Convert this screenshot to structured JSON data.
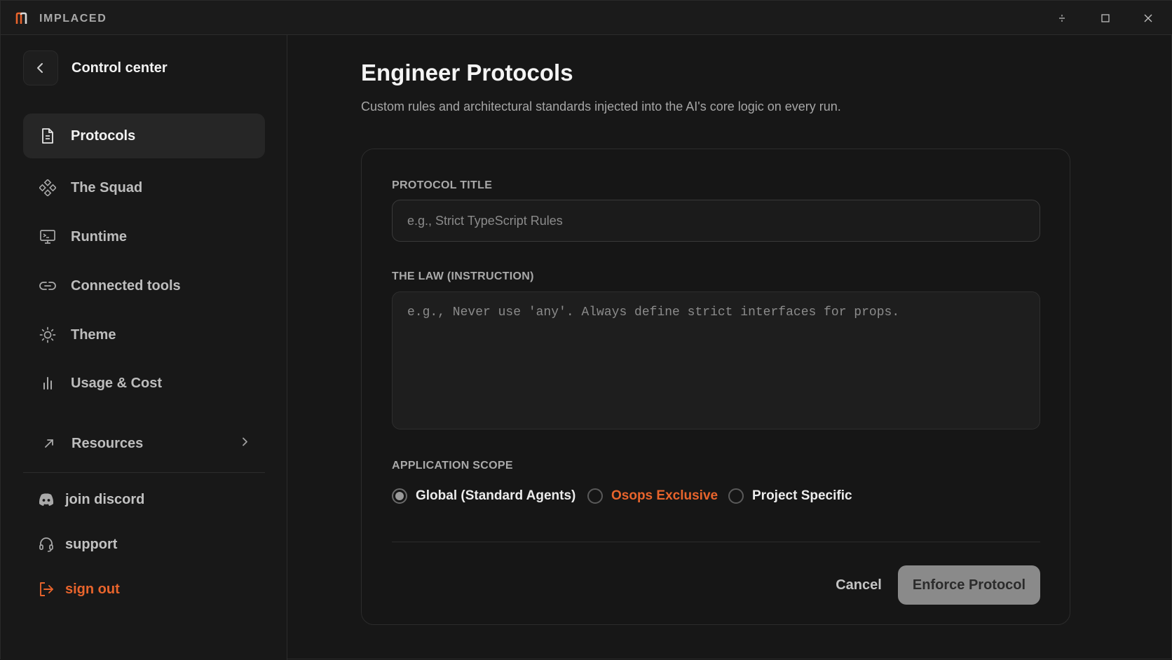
{
  "app": {
    "name": "IMPLACED"
  },
  "sidebar": {
    "title": "Control center",
    "items": [
      {
        "label": "Protocols",
        "icon": "document-icon",
        "active": true
      },
      {
        "label": "The Squad",
        "icon": "squad-diamond-icon"
      },
      {
        "label": "Runtime",
        "icon": "monitor-terminal-icon"
      },
      {
        "label": "Connected tools",
        "icon": "link-icon"
      },
      {
        "label": "Theme",
        "icon": "sun-icon"
      },
      {
        "label": "Usage & Cost",
        "icon": "bar-chart-icon"
      },
      {
        "label": "Resources",
        "icon": "arrow-up-right-icon"
      }
    ],
    "footer": [
      {
        "label": "join discord",
        "icon": "discord-icon"
      },
      {
        "label": "support",
        "icon": "headset-icon"
      },
      {
        "label": "sign out",
        "icon": "sign-out-icon"
      }
    ]
  },
  "main": {
    "title": "Engineer Protocols",
    "subtitle": "Custom rules and architectural standards injected into the AI's core logic on every run.",
    "form": {
      "title_label": "PROTOCOL TITLE",
      "title_placeholder": "e.g., Strict TypeScript Rules",
      "law_label": "THE LAW (INSTRUCTION)",
      "law_placeholder": "e.g., Never use 'any'. Always define strict interfaces for props.",
      "scope_label": "APPLICATION SCOPE",
      "scope_options": [
        {
          "label": "Global (Standard Agents)",
          "selected": true
        },
        {
          "label": "Osops Exclusive",
          "selected": false
        },
        {
          "label": "Project Specific",
          "selected": false
        }
      ],
      "cancel_label": "Cancel",
      "submit_label": "Enforce Protocol"
    }
  },
  "colors": {
    "background": "#171717",
    "accent": "#e8642c",
    "primary_button": "#8a8a8a"
  }
}
